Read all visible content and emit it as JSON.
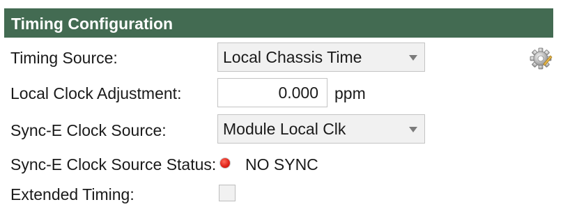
{
  "header": {
    "title": "Timing Configuration"
  },
  "timing_source": {
    "label": "Timing Source:",
    "selected": "Local Chassis Time"
  },
  "local_clock_adjustment": {
    "label": "Local Clock Adjustment:",
    "value": "0.000",
    "unit": "ppm"
  },
  "sync_e_clock_source": {
    "label": "Sync-E Clock Source:",
    "selected": "Module Local Clk"
  },
  "sync_e_clock_source_status": {
    "label": "Sync-E Clock Source Status:",
    "status": "NO SYNC",
    "indicator_color": "#e0241a"
  },
  "extended_timing": {
    "label": "Extended Timing:",
    "checked": false
  },
  "icons": {
    "settings": "gear-icon",
    "status": "status-indicator-icon",
    "dropdown_caret": "chevron-down-icon"
  },
  "colors": {
    "header_bg": "#436b52",
    "header_text": "#ffffff",
    "field_bg": "#f1f1f1"
  }
}
